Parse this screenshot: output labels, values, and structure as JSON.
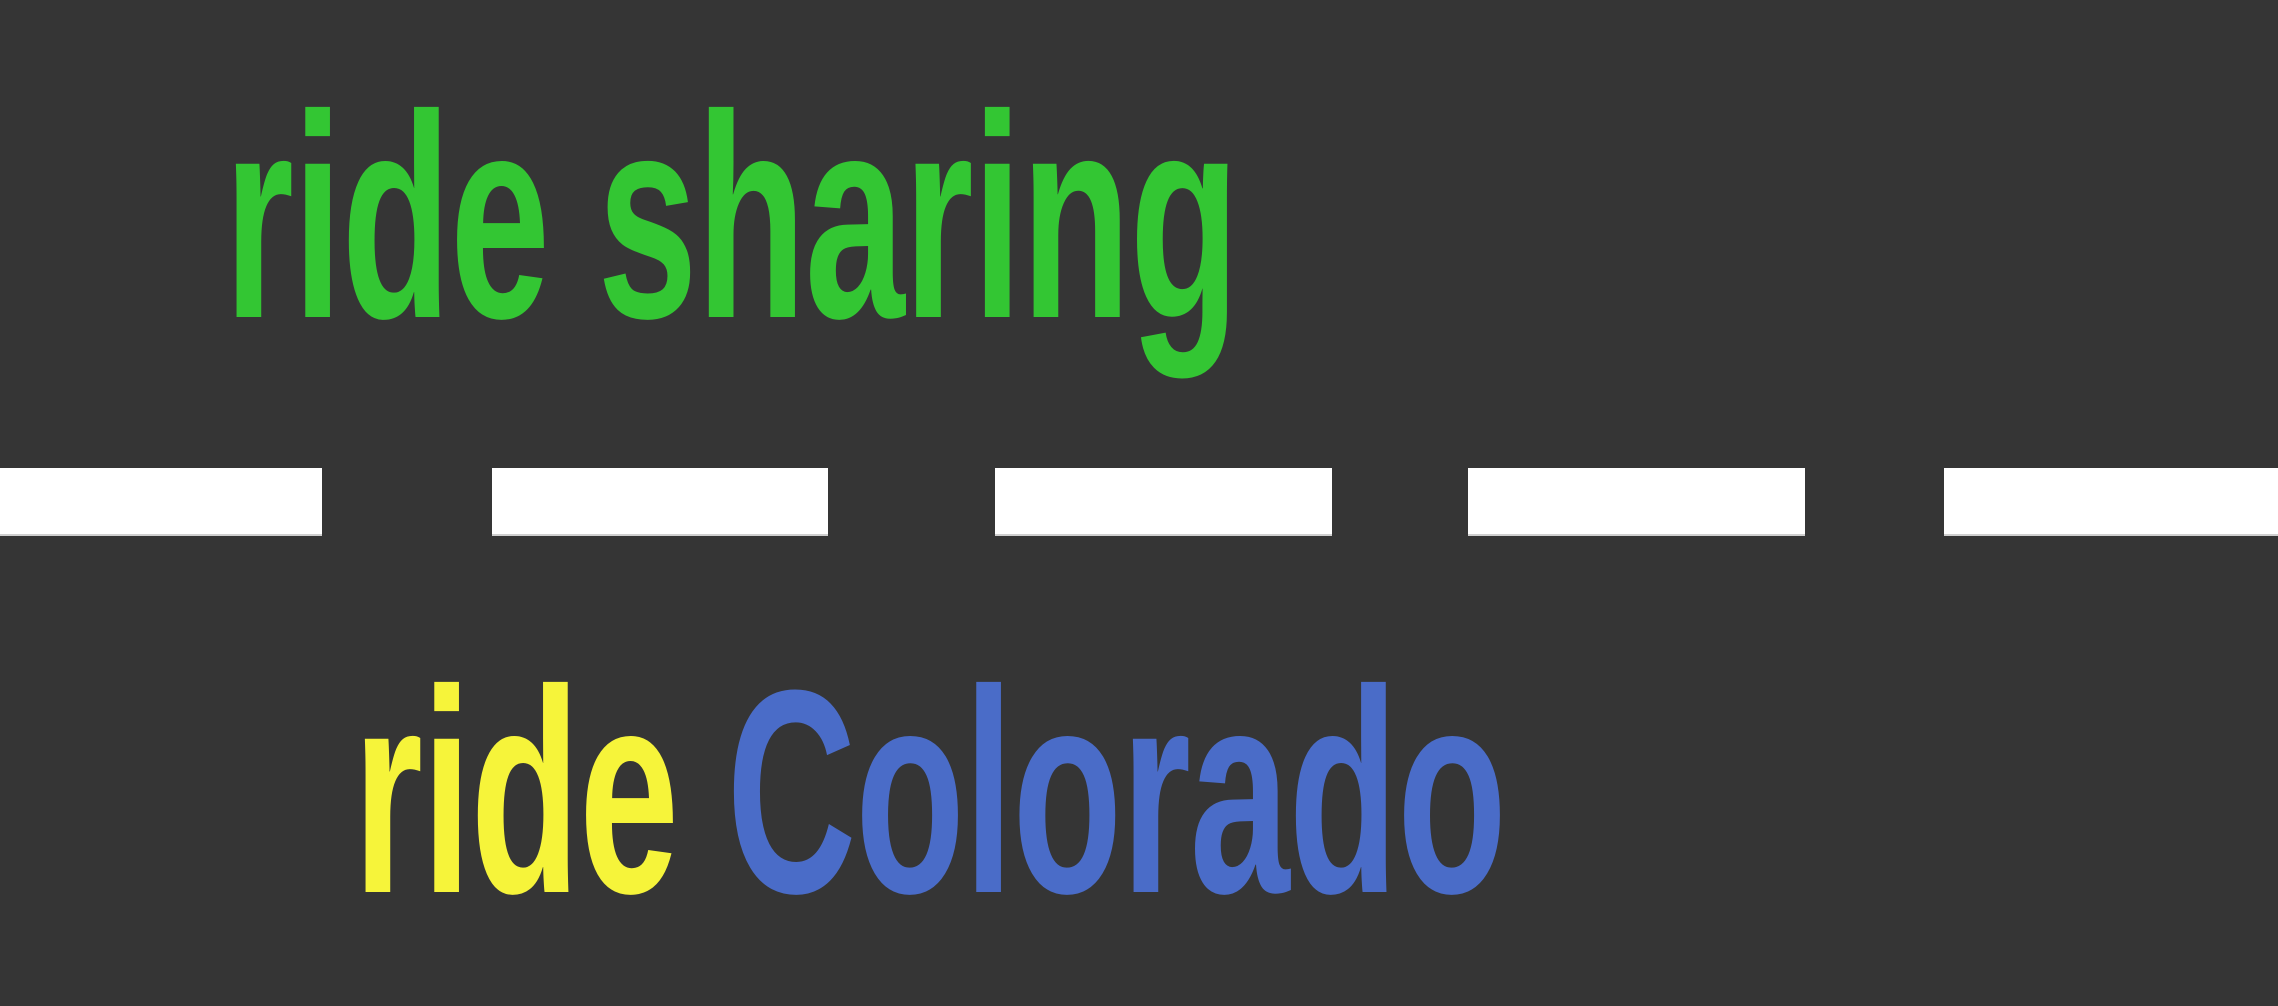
{
  "top_phrase": {
    "text": "ride sharing",
    "color": "#33c633"
  },
  "bottom_phrase": {
    "word1": "ride",
    "word1_color": "#f6f43a",
    "word2": "Colorado",
    "word2_color": "#4a6cc8"
  },
  "colors": {
    "background": "#353535",
    "lane_line": "#ffffff"
  }
}
